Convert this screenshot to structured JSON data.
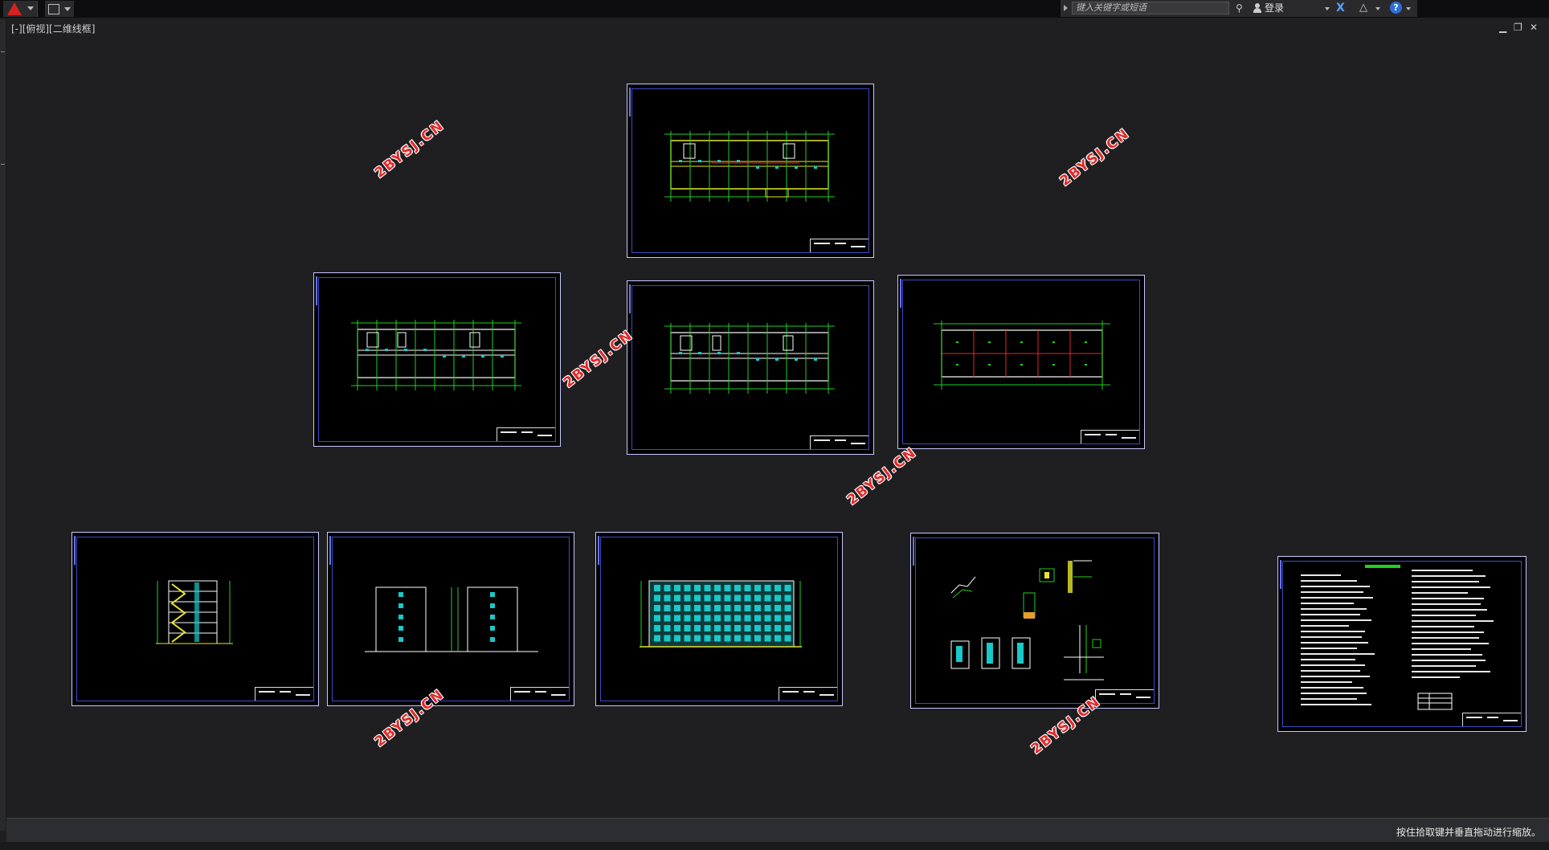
{
  "topbar": {
    "search_placeholder": "键入关键字或短语",
    "login_label": "登录",
    "help_label": "?",
    "x_label": "X",
    "tri_label": "△"
  },
  "viewport": {
    "view_label": "[-][俯视][二维线框]"
  },
  "window_controls": {
    "minimize": "▁",
    "restore": "❐",
    "close": "✕"
  },
  "watermark": {
    "text": "2BYSJ.CN"
  },
  "status": {
    "message": "按住拾取键并垂直拖动进行缩放。"
  },
  "colors": {
    "accent": "#e12a2a",
    "sheet_border": "#3b4cc9",
    "cad_green": "#1fd11f",
    "cad_cyan": "#19c8c8",
    "cad_yellow": "#e6e62a"
  },
  "icons": {
    "app": "autocad-logo-icon",
    "search": "binoculars-icon",
    "user": "user-icon",
    "exchange": "exchange-x-icon",
    "autodesk": "a360-icon",
    "help": "help-icon"
  }
}
